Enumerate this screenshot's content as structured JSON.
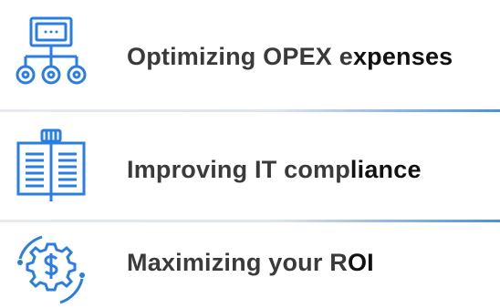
{
  "items": [
    {
      "label_a": "Optimizing OPEX e",
      "label_b": "xpenses",
      "icon": "network-computer-icon"
    },
    {
      "label_a": "Improving IT comp",
      "label_b": "liance",
      "icon": "law-book-icon"
    },
    {
      "label_a": "Maximizing your R",
      "label_b": "OI",
      "icon": "money-gear-cycle-icon"
    }
  ],
  "colors": {
    "icon_blue": "#2a7de1",
    "text": "#3a3a3a",
    "divider_accent": "#4a90d9"
  }
}
